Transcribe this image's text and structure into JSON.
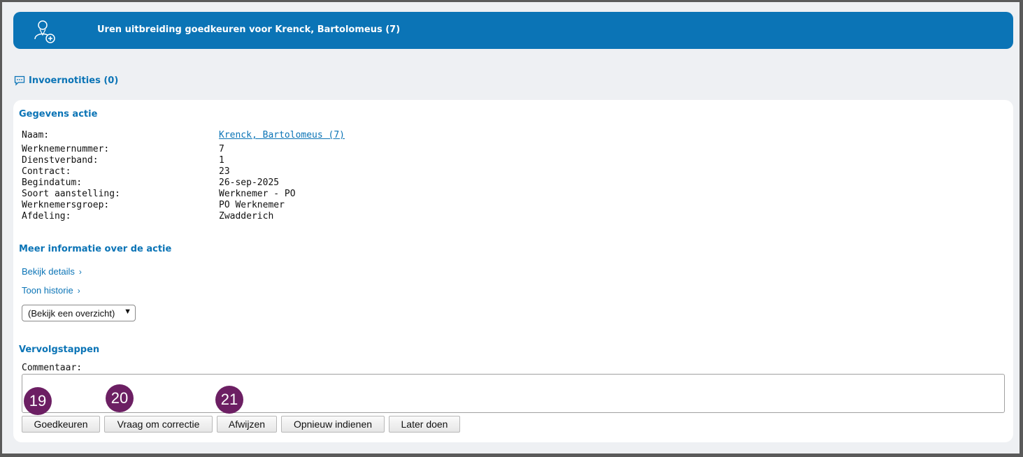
{
  "header": {
    "title": "Uren uitbreiding goedkeuren voor Krenck, Bartolomeus (7)",
    "icon": "user-add-icon"
  },
  "notes": {
    "label": "Invoernotities (0)",
    "icon": "chat-icon"
  },
  "details": {
    "section_title": "Gegevens actie",
    "rows": [
      {
        "label": "Naam:",
        "value": "Krenck, Bartolomeus (7)"
      },
      {
        "label": "Werknemernummer:",
        "value": "7"
      },
      {
        "label": "Dienstverband:",
        "value": "1"
      },
      {
        "label": "Contract:",
        "value": "23"
      },
      {
        "label": "Begindatum:",
        "value": "26-sep-2025"
      },
      {
        "label": "Soort aanstelling:",
        "value": "Werknemer - PO"
      },
      {
        "label": "Werknemersgroep:",
        "value": "PO Werknemer"
      },
      {
        "label": "Afdeling:",
        "value": "Zwadderich"
      }
    ]
  },
  "more_info": {
    "section_title": "Meer informatie over de actie",
    "details_link": "Bekijk details",
    "history_link": "Toon historie",
    "overview_select": "(Bekijk een overzicht)"
  },
  "next_steps": {
    "section_title": "Vervolgstappen",
    "comment_label": "Commentaar:",
    "comment_value": "",
    "buttons": {
      "approve": "Goedkeuren",
      "request_correction": "Vraag om correctie",
      "reject": "Afwijzen",
      "resubmit": "Opnieuw indienen",
      "later": "Later doen"
    }
  },
  "callouts": [
    "19",
    "20",
    "21"
  ],
  "colors": {
    "accent": "#0b74b6",
    "badge": "#6c1f63"
  }
}
